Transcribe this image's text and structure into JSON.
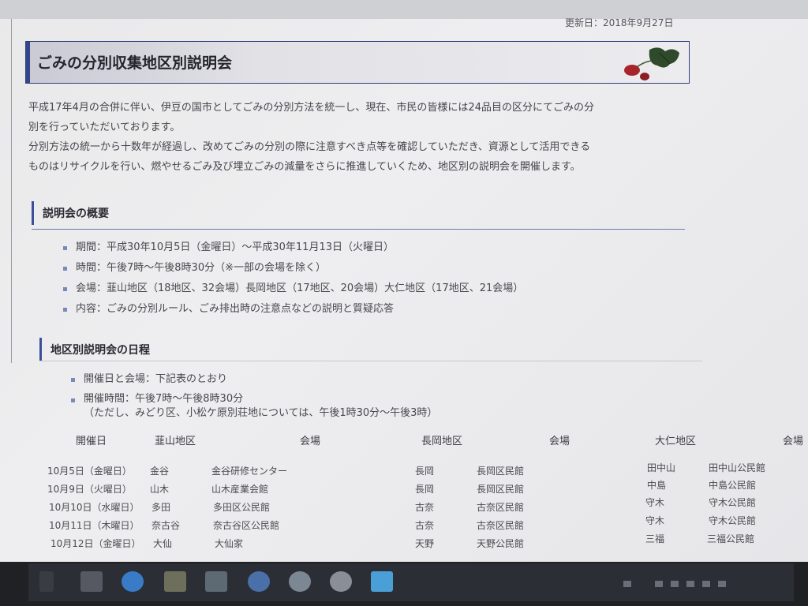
{
  "header": {
    "update_date": "更新日：2018年9月27日"
  },
  "page": {
    "title": "ごみの分別収集地区別説明会"
  },
  "intro": {
    "lines": [
      "平成17年4月の合併に伴い、伊豆の国市としてごみの分別方法を統一し、現在、市民の皆様には24品目の区分にてごみの分",
      "別を行っていただいております。",
      "分別方法の統一から十数年が経過し、改めてごみの分別の際に注意すべき点等を確認していただき、資源として活用できる",
      "ものはリサイクルを行い、燃やせるごみ及び埋立ごみの減量をさらに推進していくため、地区別の説明会を開催します。"
    ]
  },
  "overview": {
    "heading": "説明会の概要",
    "items": [
      "期間：平成30年10月5日（金曜日）～平成30年11月13日（火曜日）",
      "時間：午後7時～午後8時30分（※一部の会場を除く）",
      "会場：韮山地区（18地区、32会場）長岡地区（17地区、20会場）大仁地区（17地区、21会場）",
      "内容：ごみの分別ルール、ごみ排出時の注意点などの説明と質疑応答"
    ]
  },
  "schedule": {
    "heading": "地区別説明会の日程",
    "items": [
      "開催日と会場：下記表のとおり",
      "開催時間：午後7時～午後8時30分"
    ],
    "note": "（ただし、みどり区、小松ケ原別荘地については、午後1時30分～午後3時）"
  },
  "table": {
    "headers": [
      "開催日",
      "韮山地区",
      "会場",
      "長岡地区",
      "会場",
      "大仁地区",
      "会場"
    ],
    "rows": [
      [
        "10月5日（金曜日）",
        "金谷",
        "金谷研修センター",
        "長岡",
        "長岡区民館",
        "田中山",
        "田中山公民館"
      ],
      [
        "10月9日（火曜日）",
        "山木",
        "山木産業会館",
        "長岡",
        "長岡区民館",
        "中島",
        "中島公民館"
      ],
      [
        "10月10日（水曜日）",
        "多田",
        "多田区公民館",
        "古奈",
        "古奈区民館",
        "守木",
        "守木公民館"
      ],
      [
        "10月11日（木曜日）",
        "奈古谷",
        "奈古谷区公民館",
        "古奈",
        "古奈区民館",
        "守木",
        "守木公民館"
      ],
      [
        "10月12日（金曜日）",
        "大仙",
        "大仙家",
        "天野",
        "天野公民館",
        "三福",
        "三福公民館"
      ]
    ]
  },
  "taskbar": {
    "icons": [
      "start-icon",
      "mail-icon",
      "edge-icon",
      "explorer-icon",
      "app-icon",
      "store-icon",
      "chat-icon",
      "camera-icon",
      "photos-icon"
    ],
    "colors": {
      "bar": "#202125",
      "edge": "#3a7bc8",
      "photos": "#4a9fd6"
    }
  }
}
